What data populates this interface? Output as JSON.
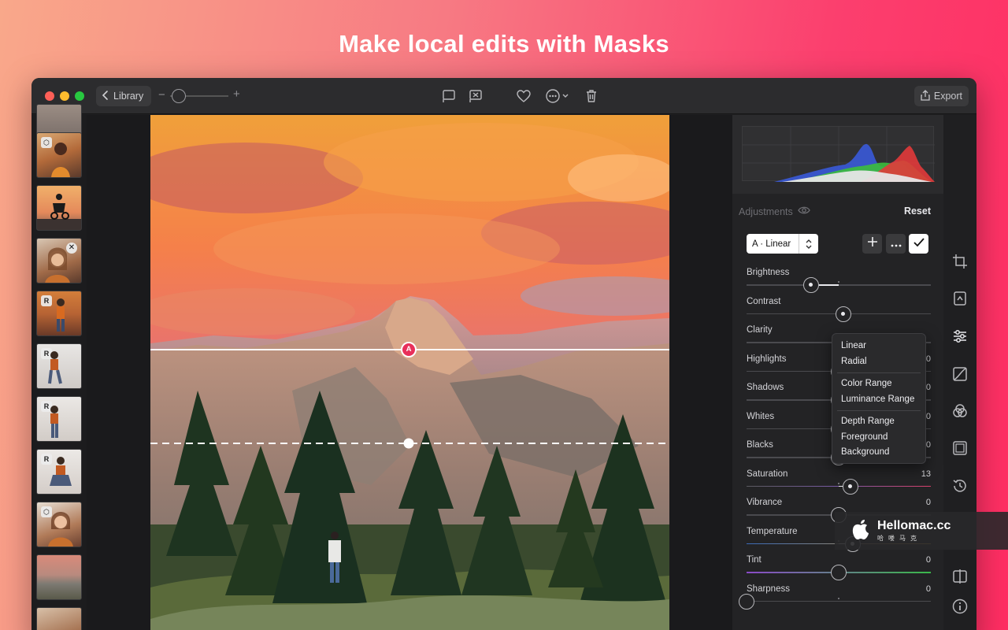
{
  "headline": "Make local edits with Masks",
  "titlebar": {
    "library_label": "Library",
    "zoom_minus": "−",
    "zoom_plus": "+",
    "export_label": "Export"
  },
  "filmstrip": {
    "thumbs": [
      {
        "badge": ""
      },
      {
        "badge": "⬡"
      },
      {
        "badge": ""
      },
      {
        "badge": "",
        "close": "✕"
      },
      {
        "badge": "R"
      },
      {
        "badge": "R"
      },
      {
        "badge": "R"
      },
      {
        "badge": "R"
      },
      {
        "badge": "⬡"
      },
      {
        "badge": ""
      },
      {
        "badge": ""
      }
    ]
  },
  "canvas": {
    "mask_marker": "A"
  },
  "adjustments": {
    "title": "Adjustments",
    "reset_label": "Reset",
    "mask_select_label": "A · Linear",
    "sliders": [
      {
        "name": "Brightness",
        "value": "",
        "level": -0.3
      },
      {
        "name": "Contrast",
        "value": "",
        "level": 0.05
      },
      {
        "name": "Clarity",
        "value": "",
        "level": 0.2
      },
      {
        "name": "Highlights",
        "value": "0",
        "level": 0
      },
      {
        "name": "Shadows",
        "value": "0",
        "level": 0
      },
      {
        "name": "Whites",
        "value": "0",
        "level": 0
      },
      {
        "name": "Blacks",
        "value": "0",
        "level": 0
      },
      {
        "name": "Saturation",
        "value": "13",
        "level": 0.13
      },
      {
        "name": "Vibrance",
        "value": "0",
        "level": 0
      },
      {
        "name": "Temperature",
        "value": "",
        "level": 0.15
      },
      {
        "name": "Tint",
        "value": "0",
        "level": 0
      },
      {
        "name": "Sharpness",
        "value": "0",
        "level": -1
      }
    ]
  },
  "mask_menu": {
    "groups": [
      [
        "Linear",
        "Radial"
      ],
      [
        "Color Range",
        "Luminance Range"
      ],
      [
        "Depth Range",
        "Foreground",
        "Background"
      ]
    ]
  },
  "watermark": {
    "title": "Hellomac.cc",
    "subtitle": "哈喽马克"
  },
  "colors": {
    "accent_mask": "#e8305a",
    "window_bg": "#1f1f21"
  }
}
